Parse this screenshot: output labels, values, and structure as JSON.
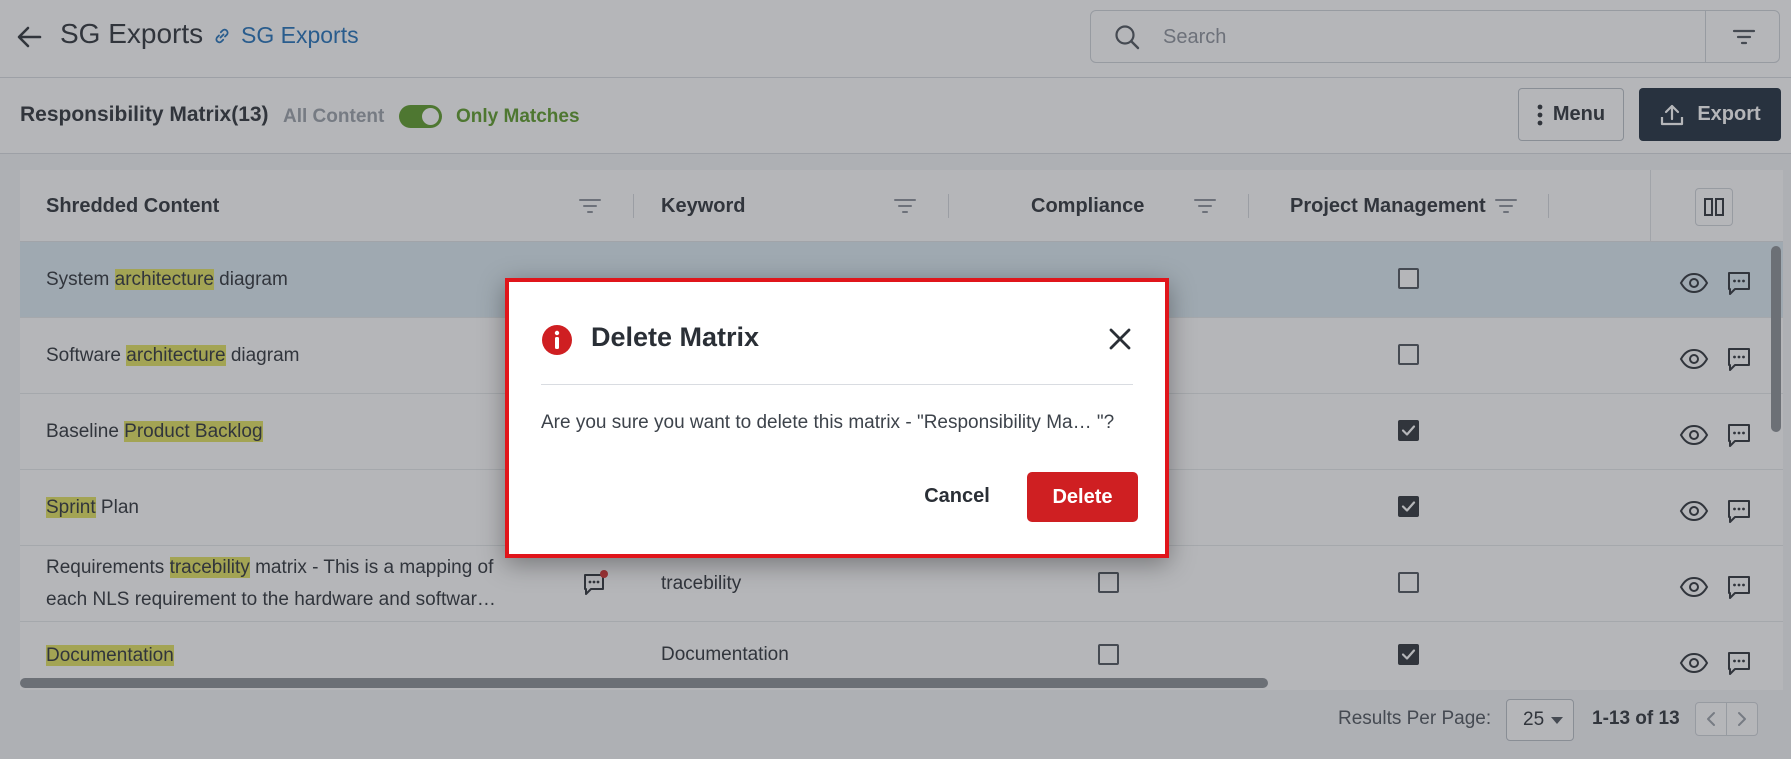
{
  "header": {
    "title": "SG Exports",
    "link_label": "SG Exports",
    "search_placeholder": "Search"
  },
  "toolbar": {
    "matrix_title": "Responsibility Matrix(13)",
    "all_content_label": "All Content",
    "only_matches_label": "Only Matches",
    "only_matches_enabled": true,
    "menu_label": "Menu",
    "export_label": "Export"
  },
  "table": {
    "columns": [
      "Shredded Content",
      "Keyword",
      "Compliance",
      "Project Management"
    ],
    "rows": [
      {
        "pre": "System ",
        "hl": "architecture",
        "post": " diagram",
        "keyword": "",
        "project_management": false,
        "selected": true
      },
      {
        "pre": "Software ",
        "hl": "architecture",
        "post": " diagram",
        "keyword": "",
        "project_management": false
      },
      {
        "pre": "Baseline ",
        "hl": "Product Backlog",
        "post": "",
        "keyword": "",
        "project_management": true
      },
      {
        "pre": "",
        "hl": "Sprint",
        "post": " Plan",
        "keyword": "",
        "project_management": true
      },
      {
        "pre": "Requirements ",
        "hl": "tracebility",
        "post": " matrix - This is a mapping of",
        "line2": "each NLS requirement to the hardware and softwar…",
        "keyword": "tracebility",
        "compliance": false,
        "project_management": false
      },
      {
        "pre": "",
        "hl": "Documentation",
        "post": "",
        "keyword": "Documentation",
        "compliance": false,
        "project_management": true
      }
    ]
  },
  "pagination": {
    "results_per_page_label": "Results Per Page:",
    "per_page_value": "25",
    "range_label": "1-13 of 13"
  },
  "modal": {
    "title": "Delete Matrix",
    "message": "Are you sure you want to delete this matrix - \"Responsibility Ma… \"?",
    "cancel_label": "Cancel",
    "delete_label": "Delete"
  },
  "colors": {
    "accent_dark": "#1c2b3a",
    "toggle_green": "#5a9a25",
    "danger_red": "#cf1f22",
    "highlight_yellow": "#e3e25c",
    "link_blue": "#1d6fb8"
  }
}
